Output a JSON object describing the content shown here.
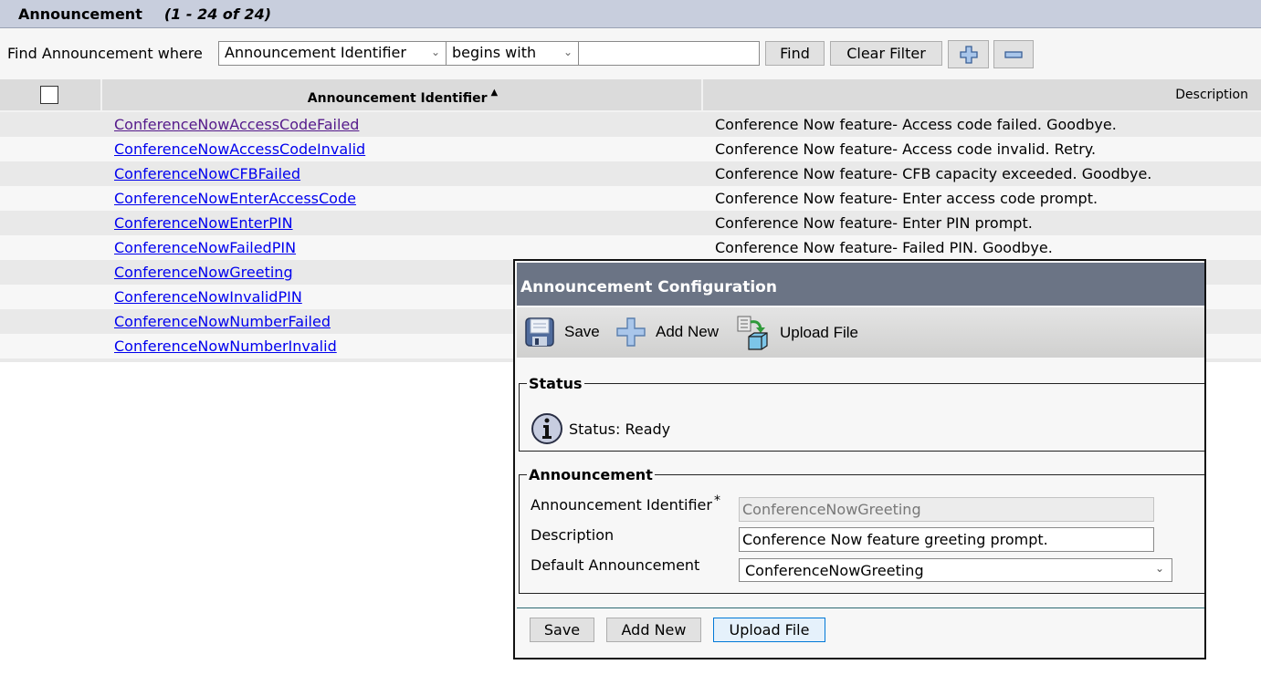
{
  "header": {
    "title": "Announcement",
    "count": "(1 - 24 of 24)"
  },
  "find_bar": {
    "label": "Find Announcement where",
    "field_select": "Announcement Identifier",
    "operator_select": "begins with",
    "search_value": "",
    "find_label": "Find",
    "clear_filter_label": "Clear Filter",
    "add_criteria_icon": "plus-icon",
    "remove_criteria_icon": "minus-icon"
  },
  "table": {
    "columns": {
      "identifier": "Announcement Identifier",
      "description": "Description"
    },
    "sort": "ascending",
    "rows": [
      {
        "id": "ConferenceNowAccessCodeFailed",
        "description": "Conference Now feature- Access code failed. Goodbye.",
        "visited": true
      },
      {
        "id": "ConferenceNowAccessCodeInvalid",
        "description": "Conference Now feature- Access code invalid. Retry."
      },
      {
        "id": "ConferenceNowCFBFailed",
        "description": "Conference Now feature- CFB capacity exceeded. Goodbye."
      },
      {
        "id": "ConferenceNowEnterAccessCode",
        "description": "Conference Now feature- Enter access code prompt."
      },
      {
        "id": "ConferenceNowEnterPIN",
        "description": "Conference Now feature- Enter PIN prompt."
      },
      {
        "id": "ConferenceNowFailedPIN",
        "description": "Conference Now feature- Failed PIN. Goodbye."
      },
      {
        "id": "ConferenceNowGreeting",
        "description": ""
      },
      {
        "id": "ConferenceNowInvalidPIN",
        "description": ""
      },
      {
        "id": "ConferenceNowNumberFailed",
        "description": ""
      },
      {
        "id": "ConferenceNowNumberInvalid",
        "description": ""
      }
    ]
  },
  "dialog": {
    "title": "Announcement Configuration",
    "toolbar": {
      "save": "Save",
      "add_new": "Add New",
      "upload_file": "Upload File"
    },
    "status": {
      "legend": "Status",
      "text": "Status: Ready"
    },
    "announcement": {
      "legend": "Announcement",
      "identifier_label": "Announcement Identifier",
      "required_mark": "*",
      "identifier_value": "ConferenceNowGreeting",
      "description_label": "Description",
      "description_value": "Conference Now feature greeting prompt.",
      "default_label": "Default Announcement",
      "default_value": "ConferenceNowGreeting"
    },
    "buttons": {
      "save": "Save",
      "add_new": "Add New",
      "upload_file": "Upload File"
    }
  }
}
